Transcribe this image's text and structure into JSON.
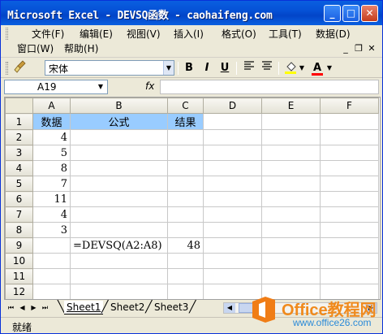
{
  "window": {
    "title": "Microsoft Excel - DEVSQ函数 - caohaifeng.com"
  },
  "title_buttons": {
    "minimize": "_",
    "maximize": "□",
    "close": "✕"
  },
  "menu": {
    "items": [
      "文件(F)",
      "编辑(E)",
      "视图(V)",
      "插入(I)",
      "格式(O)",
      "工具(T)",
      "数据(D)"
    ],
    "row2": [
      "窗口(W)",
      "帮助(H)"
    ],
    "mdi": {
      "minimize": "_",
      "restore": "❐",
      "close": "✕"
    }
  },
  "toolbar": {
    "font_name": "宋体",
    "bold": "B",
    "italic": "I",
    "underline": "U",
    "font_color_letter": "A",
    "accent_color": "#ff0000",
    "fill_color": "#ffff00"
  },
  "formula_bar": {
    "cell_ref": "A19",
    "fx_label": "fx",
    "formula": ""
  },
  "grid": {
    "columns": [
      "A",
      "B",
      "C",
      "D",
      "E",
      "F"
    ],
    "rows": [
      {
        "n": "1",
        "cells": [
          "数据",
          "公式",
          "结果",
          "",
          "",
          ""
        ]
      },
      {
        "n": "2",
        "cells": [
          "4",
          "",
          "",
          "",
          "",
          ""
        ]
      },
      {
        "n": "3",
        "cells": [
          "5",
          "",
          "",
          "",
          "",
          ""
        ]
      },
      {
        "n": "4",
        "cells": [
          "8",
          "",
          "",
          "",
          "",
          ""
        ]
      },
      {
        "n": "5",
        "cells": [
          "7",
          "",
          "",
          "",
          "",
          ""
        ]
      },
      {
        "n": "6",
        "cells": [
          "11",
          "",
          "",
          "",
          "",
          ""
        ]
      },
      {
        "n": "7",
        "cells": [
          "4",
          "",
          "",
          "",
          "",
          ""
        ]
      },
      {
        "n": "8",
        "cells": [
          "3",
          "",
          "",
          "",
          "",
          ""
        ]
      },
      {
        "n": "9",
        "cells": [
          "",
          "=DEVSQ(A2:A8)",
          "48",
          "",
          "",
          ""
        ]
      },
      {
        "n": "10",
        "cells": [
          "",
          "",
          "",
          "",
          "",
          ""
        ]
      },
      {
        "n": "11",
        "cells": [
          "",
          "",
          "",
          "",
          "",
          ""
        ]
      },
      {
        "n": "12",
        "cells": [
          "",
          "",
          "",
          "",
          "",
          ""
        ]
      }
    ],
    "header_fill": "#99ccff"
  },
  "sheets": {
    "tabs": [
      "Sheet1",
      "Sheet2",
      "Sheet3"
    ],
    "active": "Sheet1"
  },
  "status": {
    "text": "就绪"
  },
  "watermark": {
    "brand": "Office教程网",
    "site": "www.office26.com"
  }
}
